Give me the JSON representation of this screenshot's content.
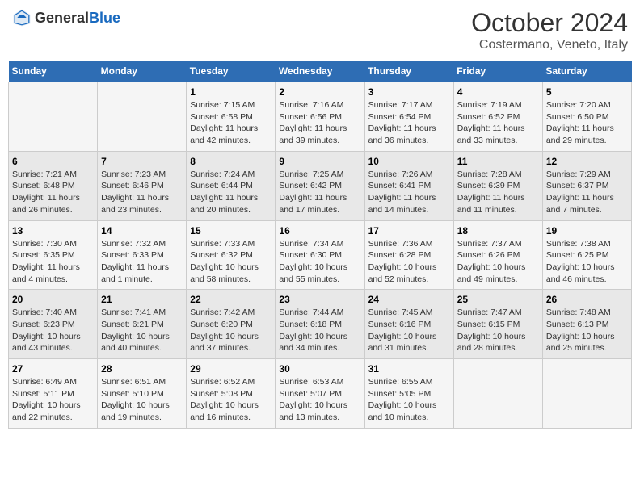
{
  "header": {
    "logo_general": "General",
    "logo_blue": "Blue",
    "month": "October 2024",
    "location": "Costermano, Veneto, Italy"
  },
  "days_of_week": [
    "Sunday",
    "Monday",
    "Tuesday",
    "Wednesday",
    "Thursday",
    "Friday",
    "Saturday"
  ],
  "weeks": [
    [
      {
        "day": "",
        "sunrise": "",
        "sunset": "",
        "daylight": ""
      },
      {
        "day": "",
        "sunrise": "",
        "sunset": "",
        "daylight": ""
      },
      {
        "day": "1",
        "sunrise": "Sunrise: 7:15 AM",
        "sunset": "Sunset: 6:58 PM",
        "daylight": "Daylight: 11 hours and 42 minutes."
      },
      {
        "day": "2",
        "sunrise": "Sunrise: 7:16 AM",
        "sunset": "Sunset: 6:56 PM",
        "daylight": "Daylight: 11 hours and 39 minutes."
      },
      {
        "day": "3",
        "sunrise": "Sunrise: 7:17 AM",
        "sunset": "Sunset: 6:54 PM",
        "daylight": "Daylight: 11 hours and 36 minutes."
      },
      {
        "day": "4",
        "sunrise": "Sunrise: 7:19 AM",
        "sunset": "Sunset: 6:52 PM",
        "daylight": "Daylight: 11 hours and 33 minutes."
      },
      {
        "day": "5",
        "sunrise": "Sunrise: 7:20 AM",
        "sunset": "Sunset: 6:50 PM",
        "daylight": "Daylight: 11 hours and 29 minutes."
      }
    ],
    [
      {
        "day": "6",
        "sunrise": "Sunrise: 7:21 AM",
        "sunset": "Sunset: 6:48 PM",
        "daylight": "Daylight: 11 hours and 26 minutes."
      },
      {
        "day": "7",
        "sunrise": "Sunrise: 7:23 AM",
        "sunset": "Sunset: 6:46 PM",
        "daylight": "Daylight: 11 hours and 23 minutes."
      },
      {
        "day": "8",
        "sunrise": "Sunrise: 7:24 AM",
        "sunset": "Sunset: 6:44 PM",
        "daylight": "Daylight: 11 hours and 20 minutes."
      },
      {
        "day": "9",
        "sunrise": "Sunrise: 7:25 AM",
        "sunset": "Sunset: 6:42 PM",
        "daylight": "Daylight: 11 hours and 17 minutes."
      },
      {
        "day": "10",
        "sunrise": "Sunrise: 7:26 AM",
        "sunset": "Sunset: 6:41 PM",
        "daylight": "Daylight: 11 hours and 14 minutes."
      },
      {
        "day": "11",
        "sunrise": "Sunrise: 7:28 AM",
        "sunset": "Sunset: 6:39 PM",
        "daylight": "Daylight: 11 hours and 11 minutes."
      },
      {
        "day": "12",
        "sunrise": "Sunrise: 7:29 AM",
        "sunset": "Sunset: 6:37 PM",
        "daylight": "Daylight: 11 hours and 7 minutes."
      }
    ],
    [
      {
        "day": "13",
        "sunrise": "Sunrise: 7:30 AM",
        "sunset": "Sunset: 6:35 PM",
        "daylight": "Daylight: 11 hours and 4 minutes."
      },
      {
        "day": "14",
        "sunrise": "Sunrise: 7:32 AM",
        "sunset": "Sunset: 6:33 PM",
        "daylight": "Daylight: 11 hours and 1 minute."
      },
      {
        "day": "15",
        "sunrise": "Sunrise: 7:33 AM",
        "sunset": "Sunset: 6:32 PM",
        "daylight": "Daylight: 10 hours and 58 minutes."
      },
      {
        "day": "16",
        "sunrise": "Sunrise: 7:34 AM",
        "sunset": "Sunset: 6:30 PM",
        "daylight": "Daylight: 10 hours and 55 minutes."
      },
      {
        "day": "17",
        "sunrise": "Sunrise: 7:36 AM",
        "sunset": "Sunset: 6:28 PM",
        "daylight": "Daylight: 10 hours and 52 minutes."
      },
      {
        "day": "18",
        "sunrise": "Sunrise: 7:37 AM",
        "sunset": "Sunset: 6:26 PM",
        "daylight": "Daylight: 10 hours and 49 minutes."
      },
      {
        "day": "19",
        "sunrise": "Sunrise: 7:38 AM",
        "sunset": "Sunset: 6:25 PM",
        "daylight": "Daylight: 10 hours and 46 minutes."
      }
    ],
    [
      {
        "day": "20",
        "sunrise": "Sunrise: 7:40 AM",
        "sunset": "Sunset: 6:23 PM",
        "daylight": "Daylight: 10 hours and 43 minutes."
      },
      {
        "day": "21",
        "sunrise": "Sunrise: 7:41 AM",
        "sunset": "Sunset: 6:21 PM",
        "daylight": "Daylight: 10 hours and 40 minutes."
      },
      {
        "day": "22",
        "sunrise": "Sunrise: 7:42 AM",
        "sunset": "Sunset: 6:20 PM",
        "daylight": "Daylight: 10 hours and 37 minutes."
      },
      {
        "day": "23",
        "sunrise": "Sunrise: 7:44 AM",
        "sunset": "Sunset: 6:18 PM",
        "daylight": "Daylight: 10 hours and 34 minutes."
      },
      {
        "day": "24",
        "sunrise": "Sunrise: 7:45 AM",
        "sunset": "Sunset: 6:16 PM",
        "daylight": "Daylight: 10 hours and 31 minutes."
      },
      {
        "day": "25",
        "sunrise": "Sunrise: 7:47 AM",
        "sunset": "Sunset: 6:15 PM",
        "daylight": "Daylight: 10 hours and 28 minutes."
      },
      {
        "day": "26",
        "sunrise": "Sunrise: 7:48 AM",
        "sunset": "Sunset: 6:13 PM",
        "daylight": "Daylight: 10 hours and 25 minutes."
      }
    ],
    [
      {
        "day": "27",
        "sunrise": "Sunrise: 6:49 AM",
        "sunset": "Sunset: 5:11 PM",
        "daylight": "Daylight: 10 hours and 22 minutes."
      },
      {
        "day": "28",
        "sunrise": "Sunrise: 6:51 AM",
        "sunset": "Sunset: 5:10 PM",
        "daylight": "Daylight: 10 hours and 19 minutes."
      },
      {
        "day": "29",
        "sunrise": "Sunrise: 6:52 AM",
        "sunset": "Sunset: 5:08 PM",
        "daylight": "Daylight: 10 hours and 16 minutes."
      },
      {
        "day": "30",
        "sunrise": "Sunrise: 6:53 AM",
        "sunset": "Sunset: 5:07 PM",
        "daylight": "Daylight: 10 hours and 13 minutes."
      },
      {
        "day": "31",
        "sunrise": "Sunrise: 6:55 AM",
        "sunset": "Sunset: 5:05 PM",
        "daylight": "Daylight: 10 hours and 10 minutes."
      },
      {
        "day": "",
        "sunrise": "",
        "sunset": "",
        "daylight": ""
      },
      {
        "day": "",
        "sunrise": "",
        "sunset": "",
        "daylight": ""
      }
    ]
  ]
}
